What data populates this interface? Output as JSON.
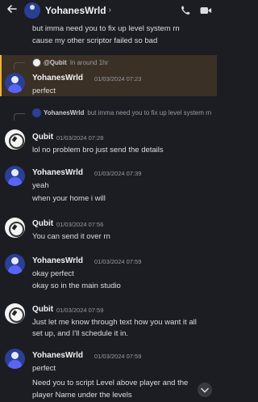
{
  "header": {
    "back_icon": "back-arrow-icon",
    "title": "YohanesWrld",
    "chevron": "›",
    "call_icon": "phone-icon",
    "video_icon": "video-camera-icon"
  },
  "messages": {
    "top_line1": "but imma need you to fix up level system rn",
    "top_line2": "cause my other scriptor failed so bad",
    "m1": {
      "reply_name": "@Qubit",
      "reply_text": "In around 1hr",
      "name": "YohanesWrld",
      "ts": "01/03/2024 07:23",
      "lines": [
        "perfect"
      ]
    },
    "m2": {
      "reply_name": "YohanesWrld",
      "reply_text": "but imma need you to fix up level system rn",
      "name": "Qubit",
      "ts": "01/03/2024 07:28",
      "lines": [
        "lol no problem bro just send the details"
      ]
    },
    "m3": {
      "name": "YohanesWrld",
      "ts": "01/03/2024 07:39",
      "lines": [
        "yeah",
        "when your home i will"
      ]
    },
    "m4": {
      "name": "Qubit",
      "ts": "01/03/2024 07:56",
      "lines": [
        "You can send it over rn"
      ]
    },
    "m5": {
      "name": "YohanesWrld",
      "ts": "01/03/2024 07:59",
      "lines": [
        "okay perfect",
        "okay so in the main studio"
      ]
    },
    "m6": {
      "name": "Qubit",
      "ts": "01/03/2024 07:59",
      "lines": [
        "Just let me know through text how you want it all",
        "set up, and I'll schedule it in."
      ]
    },
    "m7": {
      "name": "YohanesWrld",
      "ts": "01/03/2024 07:59",
      "lines": [
        "perfect",
        "Need you to script Level above player and the",
        "player Name under the levels"
      ]
    }
  },
  "colors": {
    "background": "#1c1d22",
    "highlight": "#3b3025",
    "highlight_bar": "#f0b232"
  },
  "scroll_icon": "chevron-down-icon"
}
